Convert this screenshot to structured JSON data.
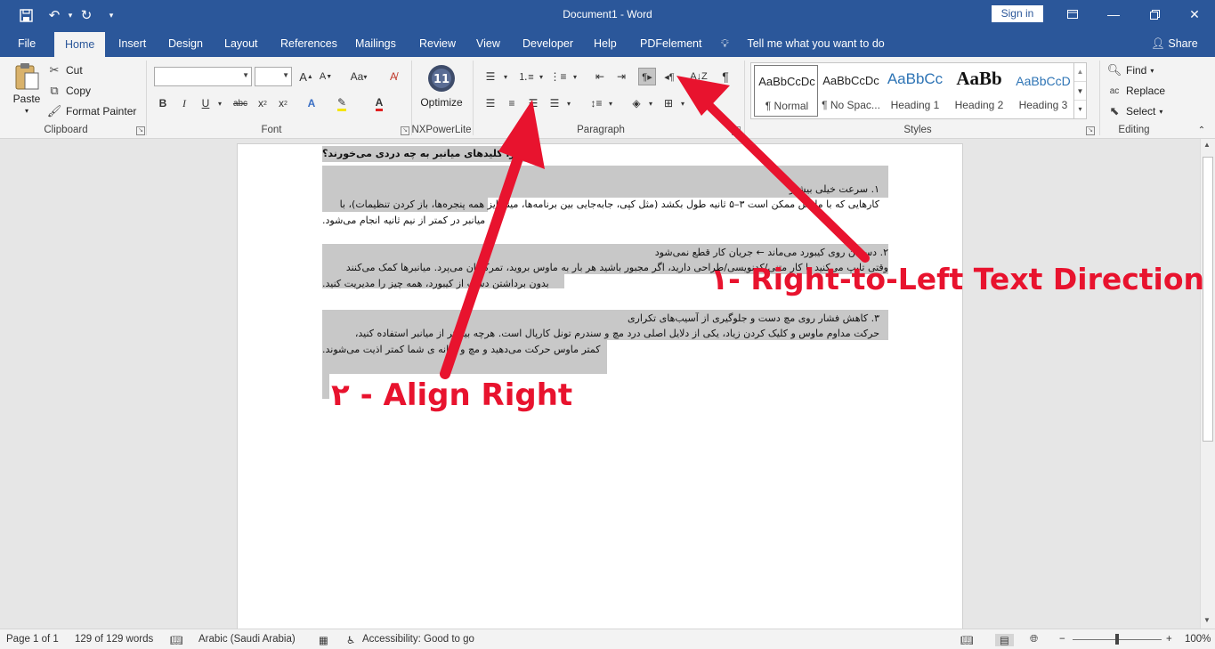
{
  "window": {
    "doc_title": "Document1  -  Word",
    "signin_label": "Sign in"
  },
  "tabs": [
    "File",
    "Home",
    "Insert",
    "Design",
    "Layout",
    "References",
    "Mailings",
    "Review",
    "View",
    "Developer",
    "Help",
    "PDFelement"
  ],
  "tell_me": "Tell me what you want to do",
  "share_label": "Share",
  "clipboard": {
    "paste": "Paste",
    "cut": "Cut",
    "copy": "Copy",
    "format_painter": "Format Painter",
    "group_label": "Clipboard"
  },
  "font": {
    "group_label": "Font",
    "aa_label": "Aa"
  },
  "nxpowerlite": {
    "optimize": "Optimize",
    "group_label": "NXPowerLite"
  },
  "paragraph": {
    "group_label": "Paragraph"
  },
  "styles": {
    "group_label": "Styles",
    "items": [
      {
        "sample": "AaBbCcDc",
        "name": "¶ Normal"
      },
      {
        "sample": "AaBbCcDc",
        "name": "¶ No Spac..."
      },
      {
        "sample": "AaBbCc",
        "name": "Heading 1"
      },
      {
        "sample": "AaBb",
        "name": "Heading 2"
      },
      {
        "sample": "AaBbCcD",
        "name": "Heading 3"
      }
    ]
  },
  "editing": {
    "find": "Find",
    "replace": "Replace",
    "select": "Select",
    "group_label": "Editing"
  },
  "document": {
    "heading": "چرا کلیدهای میانبر به چه دردی می‌خورند؟",
    "p1_line1": "۱.           سرعت                                    خیلی                                   بیشتر",
    "p1_line2": "کارهایی که با ماوس ممکن است ۳–۵ ثانیه طول بکشد (مثل کپی، جابه‌جایی بین برنامه‌ها، مینیمایز همه پنجره‌ها، باز کردن تنظیمات)، با",
    "p1_line3": "میانبر در کمتر از نیم ثانیه انجام می‌شود.",
    "p2_line1": "۲.     دستتان     روی     کیبورد     می‌ماند     ←     جریان     کار     قطع     نمی‌شود",
    "p2_line2": "وقتی تایپ می‌کنید یا کار متنی/کدنویسی/طراحی دارید، اگر مجبور باشید هر بار به ماوس بروید، تمرکزتان می‌پرد. میانبرها کمک می‌کنند",
    "p2_line3": "بدون برداشتن دست از کیبورد، همه چیز را مدیریت کنید.",
    "p3_line1": "۳.     کاهش     فشار     روی     مچ     دست     و     جلوگیری     از     آسیب‌های     تکراری",
    "p3_line2": "حرکت مداوم ماوس و کلیک کردن زیاد، یکی از دلایل اصلی درد مچ و سندرم تونل کارپال است. هرچه بیشتر از میانبر استفاده کنید،",
    "p3_line3": "کمتر ماوس حرکت می‌دهید و مچ و شانه ی شما کمتر اذیت می‌شوند."
  },
  "annotations": {
    "rtl": "۱- Right-to-Left Text Direction",
    "align_right": "۲ - Align Right",
    "color": "#e8132e"
  },
  "status": {
    "page": "Page 1 of 1",
    "words": "129 of 129 words",
    "language": "Arabic (Saudi Arabia)",
    "accessibility": "Accessibility: Good to go",
    "zoom": "100%"
  }
}
